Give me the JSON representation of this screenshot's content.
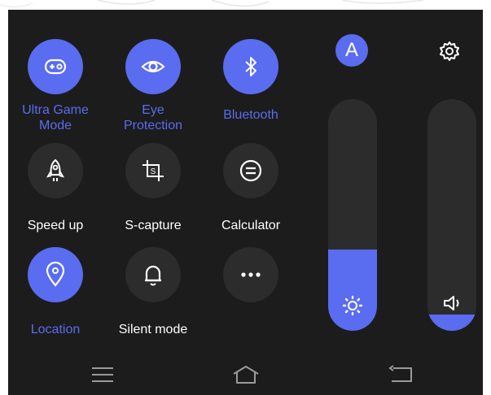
{
  "tiles": [
    {
      "id": "ultra-game-mode",
      "label": "Ultra Game\nMode",
      "icon": "gamepad-icon",
      "active": true
    },
    {
      "id": "eye-protection",
      "label": "Eye\nProtection",
      "icon": "eye-icon",
      "active": true
    },
    {
      "id": "bluetooth",
      "label": "Bluetooth",
      "icon": "bluetooth-icon",
      "active": true
    },
    {
      "id": "speed-up",
      "label": "Speed up",
      "icon": "rocket-icon",
      "active": false
    },
    {
      "id": "s-capture",
      "label": "S-capture",
      "icon": "crop-icon",
      "active": false
    },
    {
      "id": "calculator",
      "label": "Calculator",
      "icon": "calculator-icon",
      "active": false
    },
    {
      "id": "location",
      "label": "Location",
      "icon": "location-pin-icon",
      "active": true
    },
    {
      "id": "silent-mode",
      "label": "Silent mode",
      "icon": "bell-icon",
      "active": false
    },
    {
      "id": "more",
      "label": "",
      "icon": "more-icon",
      "active": false
    }
  ],
  "auto_brightness_letter": "A",
  "brightness_level": 0.35,
  "volume_level": 0.07,
  "colors": {
    "accent": "#5a6cf0",
    "panel": "#1c1c1c",
    "tile": "#2c2c2c",
    "text": "#ffffff"
  },
  "icons": {
    "settings": "gear-icon",
    "brightness": "sun-icon",
    "volume": "speaker-icon",
    "nav_menu": "menu-icon",
    "nav_home": "home-icon",
    "nav_back": "back-icon"
  }
}
